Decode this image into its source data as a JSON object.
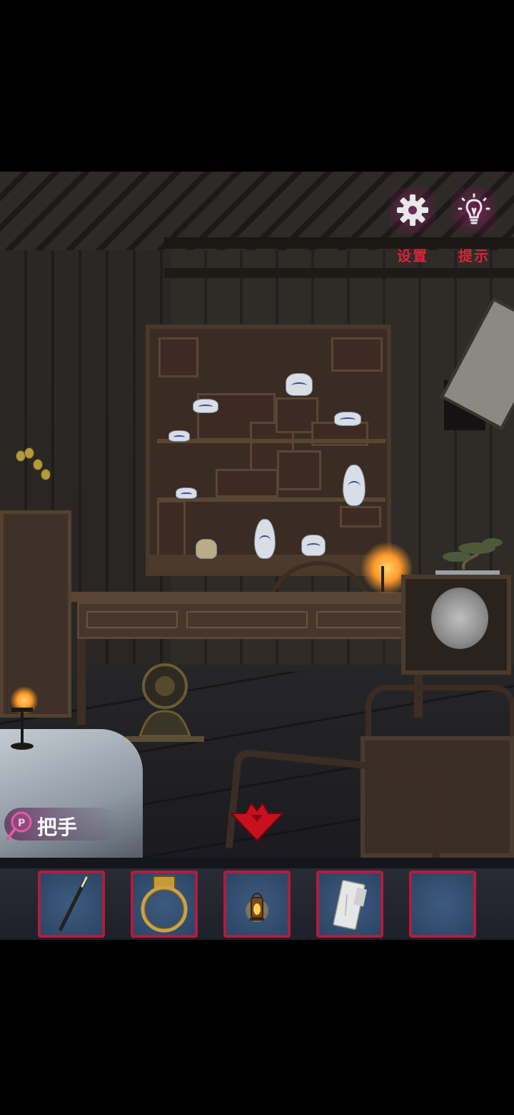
{
  "hud": {
    "settings_label": "设置",
    "hint_label": "提示"
  },
  "selected_item": {
    "name": "把手",
    "icon": "magnifier-icon"
  },
  "navigation": {
    "back_icon": "red-down-arrow-icon"
  },
  "inventory": {
    "slots": [
      {
        "item": "incense-stick-icon"
      },
      {
        "item": "brass-ring-handle-icon"
      },
      {
        "item": "oil-lantern-icon"
      },
      {
        "item": "paper-note-icon"
      },
      {
        "item": ""
      }
    ],
    "accent_color": "#b21c3e"
  },
  "colors": {
    "hud_label": "#d8233a",
    "letterbox": "#000000"
  }
}
